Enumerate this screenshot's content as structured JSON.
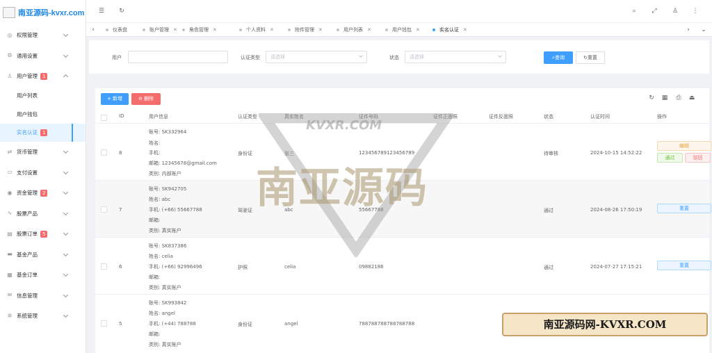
{
  "brand": {
    "title": "南亚源码-kvxr.com"
  },
  "sidebar": {
    "items": [
      {
        "label": "权限管理",
        "icon": "shield-icon"
      },
      {
        "label": "通用设置",
        "icon": "gear-icon"
      },
      {
        "label": "用户管理",
        "icon": "user-icon",
        "badge": "1"
      },
      {
        "label": "货币管理",
        "icon": "currency-icon"
      },
      {
        "label": "支付设置",
        "icon": "payment-icon"
      },
      {
        "label": "资金管理",
        "icon": "fund-icon",
        "badge": "2"
      },
      {
        "label": "股票产品",
        "icon": "stock-icon"
      },
      {
        "label": "股票订单",
        "icon": "order-icon",
        "badge": "5"
      },
      {
        "label": "基金产品",
        "icon": "fund-product-icon"
      },
      {
        "label": "基金订单",
        "icon": "fund-order-icon"
      },
      {
        "label": "信息管理",
        "icon": "message-icon"
      },
      {
        "label": "系统管理",
        "icon": "system-icon"
      }
    ],
    "sub_items": [
      {
        "label": "用户列表"
      },
      {
        "label": "用户钱包"
      },
      {
        "label": "实名认证",
        "badge": "1"
      }
    ]
  },
  "tabs": [
    {
      "label": "仪表盘"
    },
    {
      "label": "账户管理"
    },
    {
      "label": "角色管理"
    },
    {
      "label": "个人资料"
    },
    {
      "label": "附件管理"
    },
    {
      "label": "用户列表"
    },
    {
      "label": "用户钱包"
    },
    {
      "label": "实名认证"
    }
  ],
  "filter": {
    "user_label": "用户",
    "type_label": "认证类型",
    "type_placeholder": "请选择",
    "status_label": "状态",
    "status_placeholder": "请选择",
    "search_button": "查询",
    "reset_button": "重置"
  },
  "toolbar": {
    "add_button": "新增",
    "delete_button": "删除"
  },
  "table": {
    "headers": [
      "ID",
      "用户信息",
      "认证类型",
      "真实姓名",
      "证件号码",
      "证件正面照",
      "证件反面照",
      "状态",
      "认证时间",
      "操作"
    ],
    "rows": [
      {
        "id": "8",
        "info": [
          "账号: SK332964",
          "姓名:",
          "手机:",
          "邮箱: 12345678@gmail.com",
          "类别: 内部账户"
        ],
        "type": "身份证",
        "name": "张三",
        "doc_no": "123456789123456789",
        "status": "待审核",
        "time": "2024-10-15 14:52:22",
        "ops": [
          "编辑",
          "通过",
          "驳回"
        ]
      },
      {
        "id": "7",
        "info": [
          "账号: SK942705",
          "姓名: abc",
          "手机: (+66) 55667788",
          "邮箱:",
          "类别: 真实账户"
        ],
        "type": "驾驶证",
        "name": "abc",
        "doc_no": "55667788",
        "status": "通过",
        "time": "2024-08-26 17:50:19",
        "ops": [
          "重置"
        ]
      },
      {
        "id": "6",
        "info": [
          "账号: SK837386",
          "姓名: celia",
          "手机: (+66) 92996496",
          "邮箱:",
          "类别: 真实账户"
        ],
        "type": "护照",
        "name": "celia",
        "doc_no": "09882186",
        "status": "通过",
        "time": "2024-07-27 17:15:21",
        "ops": [
          "重置"
        ]
      },
      {
        "id": "5",
        "info": [
          "账号: SK993842",
          "姓名: angel",
          "手机: (+44) 788788",
          "邮箱:",
          "类别: 真实账户"
        ],
        "type": "身份证",
        "name": "angel",
        "doc_no": "788788788788788788",
        "status": "",
        "time": "",
        "ops": []
      }
    ]
  },
  "watermark": {
    "small": "KVXR.COM",
    "big": "南亚源码",
    "banner": "南亚源码网-KVXR.COM"
  }
}
